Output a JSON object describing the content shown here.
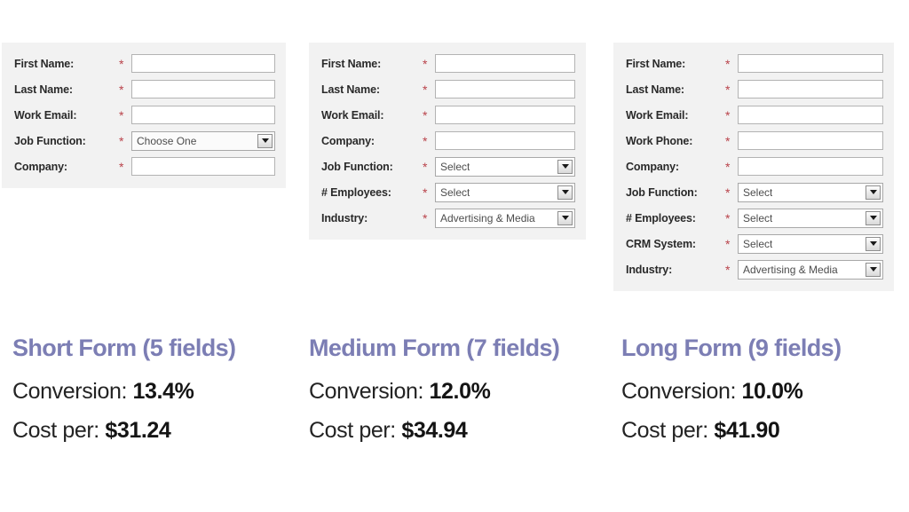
{
  "forms": [
    {
      "id": "short",
      "rows": [
        {
          "label": "First Name:",
          "required": "*",
          "type": "text",
          "value": ""
        },
        {
          "label": "Last Name:",
          "required": "*",
          "type": "text",
          "value": ""
        },
        {
          "label": "Work Email:",
          "required": "*",
          "type": "text",
          "value": ""
        },
        {
          "label": "Job Function:",
          "required": "*",
          "type": "select",
          "value": "Choose One"
        },
        {
          "label": "Company:",
          "required": "*",
          "type": "text",
          "value": ""
        }
      ]
    },
    {
      "id": "medium",
      "rows": [
        {
          "label": "First Name:",
          "required": "*",
          "type": "text",
          "value": ""
        },
        {
          "label": "Last Name:",
          "required": "*",
          "type": "text",
          "value": ""
        },
        {
          "label": "Work Email:",
          "required": "*",
          "type": "text",
          "value": ""
        },
        {
          "label": "Company:",
          "required": "*",
          "type": "text",
          "value": ""
        },
        {
          "label": "Job Function:",
          "required": "*",
          "type": "select",
          "value": "Select"
        },
        {
          "label": "# Employees:",
          "required": "*",
          "type": "select",
          "value": "Select"
        },
        {
          "label": "Industry:",
          "required": "*",
          "type": "select",
          "value": "Advertising & Media"
        }
      ]
    },
    {
      "id": "long",
      "rows": [
        {
          "label": "First Name:",
          "required": "*",
          "type": "text",
          "value": ""
        },
        {
          "label": "Last Name:",
          "required": "*",
          "type": "text",
          "value": ""
        },
        {
          "label": "Work Email:",
          "required": "*",
          "type": "text",
          "value": ""
        },
        {
          "label": "Work Phone:",
          "required": "*",
          "type": "text",
          "value": ""
        },
        {
          "label": "Company:",
          "required": "*",
          "type": "text",
          "value": ""
        },
        {
          "label": "Job Function:",
          "required": "*",
          "type": "select",
          "value": "Select"
        },
        {
          "label": "# Employees:",
          "required": "*",
          "type": "select",
          "value": "Select"
        },
        {
          "label": "CRM System:",
          "required": "*",
          "type": "select",
          "value": "Select"
        },
        {
          "label": "Industry:",
          "required": "*",
          "type": "select",
          "value": "Advertising & Media"
        }
      ]
    }
  ],
  "captions": [
    {
      "title": "Short Form (5 fields)",
      "conversion_label": "Conversion: ",
      "conversion_value": "13.4%",
      "cost_label": "Cost per: ",
      "cost_value": "$31.24"
    },
    {
      "title": "Medium Form (7 fields)",
      "conversion_label": "Conversion: ",
      "conversion_value": "12.0%",
      "cost_label": "Cost per: ",
      "cost_value": "$34.94"
    },
    {
      "title": "Long Form (9 fields)",
      "conversion_label": "Conversion: ",
      "conversion_value": "10.0%",
      "cost_label": "Cost per: ",
      "cost_value": "$41.90"
    }
  ],
  "colors": {
    "heading_purple": "#7c7eb4",
    "required_star_red": "#b9424a",
    "panel_background": "#f2f2f2",
    "body_text": "#232323",
    "page_background": "#ffffff"
  },
  "chart_data": {
    "type": "table",
    "title": "Form Length vs. Conversion Rate and Cost per Lead",
    "categories": [
      "Short Form (5 fields)",
      "Medium Form (7 fields)",
      "Long Form (9 fields)"
    ],
    "field_counts": [
      5,
      7,
      9
    ],
    "series": [
      {
        "name": "Conversion",
        "values": [
          13.4,
          12.0,
          10.0
        ],
        "unit": "%"
      },
      {
        "name": "Cost per",
        "values": [
          31.24,
          34.94,
          41.9
        ],
        "unit": "$"
      }
    ],
    "xlabel": "",
    "ylabel": "",
    "legend": [
      "Conversion",
      "Cost per"
    ]
  }
}
